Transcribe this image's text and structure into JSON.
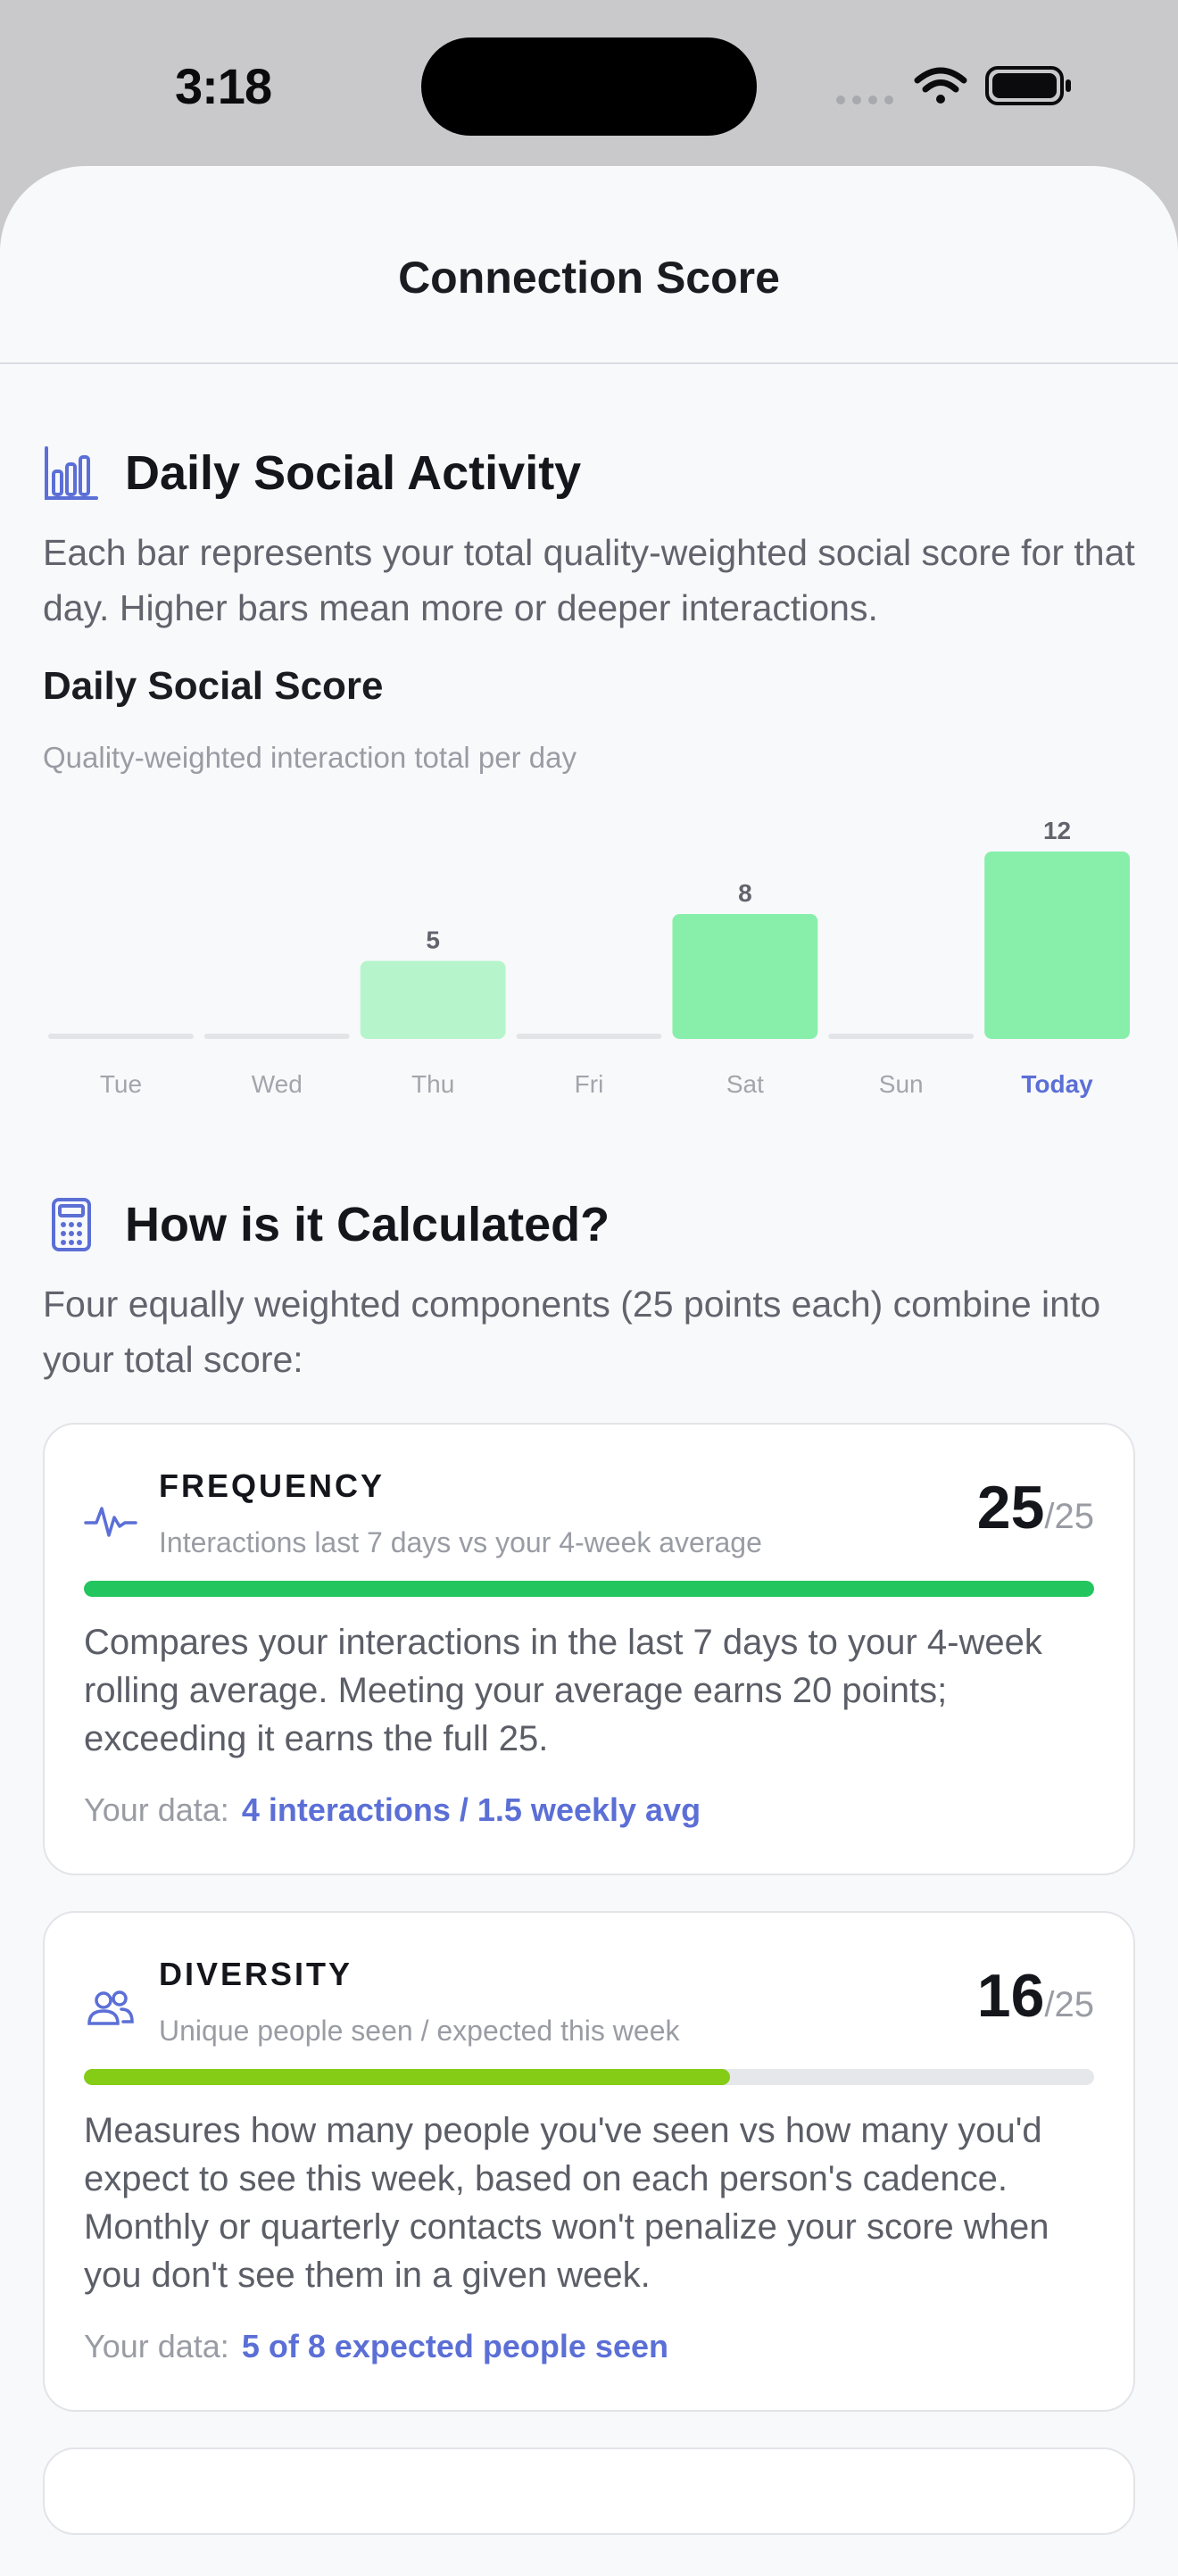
{
  "status": {
    "time": "3:18"
  },
  "nav": {
    "title": "Connection Score"
  },
  "activity": {
    "title": "Daily Social Activity",
    "icon": "bar-chart-icon",
    "description": "Each bar represents your total quality-weighted social score for that day. Higher bars mean more or deeper interactions."
  },
  "chart_data": {
    "type": "bar",
    "title": "Daily Social Score",
    "subtitle": "Quality-weighted interaction total per day",
    "categories": [
      "Tue",
      "Wed",
      "Thu",
      "Fri",
      "Sat",
      "Sun",
      "Today"
    ],
    "values": [
      0,
      0,
      5,
      0,
      8,
      0,
      12
    ],
    "data_labels": [
      "",
      "",
      "5",
      "",
      "8",
      "",
      "12"
    ],
    "highlight_category": "Today",
    "ylim": [
      0,
      12
    ],
    "colors": {
      "bar_light": "#b6f5cc",
      "bar_strong": "#87efaa",
      "empty": "#e3e4e8",
      "today_label": "#5b6fd6"
    }
  },
  "calc": {
    "title": "How is it Calculated?",
    "icon": "calculator-icon",
    "description": "Four equally weighted components (25 points each) combine into your total score:"
  },
  "cards": [
    {
      "icon": "heartbeat-icon",
      "title": "FREQUENCY",
      "subtitle": "Interactions last 7 days vs your 4-week average",
      "score": "25",
      "max": "/25",
      "progress": 1.0,
      "color": "#22c55e",
      "text": "Compares your interactions in the last 7 days to your 4-week rolling average. Meeting your average earns 20 points; exceeding it earns the full 25.",
      "data_label": "Your data:",
      "data_value": "4 interactions / 1.5 weekly avg"
    },
    {
      "icon": "people-icon",
      "title": "DIVERSITY",
      "subtitle": "Unique people seen / expected this week",
      "score": "16",
      "max": "/25",
      "progress": 0.64,
      "color": "#84cc16",
      "text": "Measures how many people you've seen vs how many you'd expect to see this week, based on each person's cadence. Monthly or quarterly contacts won't penalize your score when you don't see them in a given week.",
      "data_label": "Your data:",
      "data_value": "5 of 8 expected people seen"
    }
  ]
}
